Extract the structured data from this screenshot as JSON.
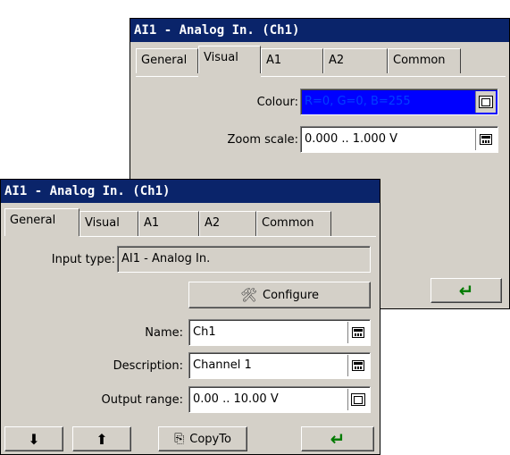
{
  "back_dialog": {
    "title": "AI1 - Analog In. (Ch1)",
    "tabs": [
      "General",
      "Visual",
      "A1",
      "A2",
      "Common"
    ],
    "active_tab": "Visual",
    "colour_label": "Colour:",
    "colour_value": "R=0, G=0, B=255",
    "colour_hex": "#0000ff",
    "zoom_label": "Zoom scale:",
    "zoom_value": "0.000 .. 1.000 V",
    "enter_icon": "enter-arrow-icon"
  },
  "front_dialog": {
    "title": "AI1 - Analog In. (Ch1)",
    "tabs": [
      "General",
      "Visual",
      "A1",
      "A2",
      "Common"
    ],
    "active_tab": "General",
    "input_type_label": "Input type:",
    "input_type_value": "AI1 - Analog In.",
    "configure_label": "Configure",
    "name_label": "Name:",
    "name_value": "Ch1",
    "description_label": "Description:",
    "description_value": "Channel 1",
    "output_range_label": "Output range:",
    "output_range_value": "0.00 .. 10.00 V",
    "copyto_label": "CopyTo",
    "icons": [
      "save-down-icon",
      "load-up-icon",
      "copy-icon",
      "configure-tool-icon",
      "calculator-icon",
      "properties-icon",
      "enter-arrow-icon"
    ]
  }
}
